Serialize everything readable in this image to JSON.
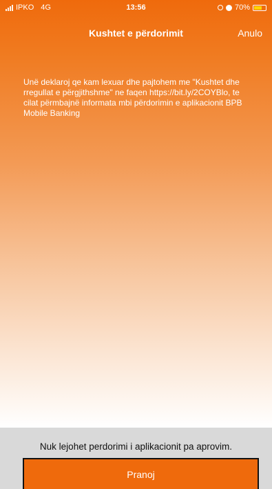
{
  "status_bar": {
    "carrier": "IPKO",
    "network": "4G",
    "time": "13:56",
    "battery": "70%",
    "battery_color": "#ffd400"
  },
  "nav": {
    "title": "Kushtet e përdorimit",
    "cancel_label": "Anulo"
  },
  "content": {
    "terms_text": "Unë deklaroj qe kam lexuar dhe pajtohem me \"Kushtet dhe rregullat e përgjithshme\" ne faqen https://bit.ly/2COYBlo, te cilat përmbajnë informata mbi përdorimin e aplikacionit BPB Mobile Banking"
  },
  "footer": {
    "notice": "Nuk lejohet perdorimi i aplikacionit pa aprovim.",
    "accept_label": "Pranoj"
  },
  "colors": {
    "accent": "#ef6a0c",
    "panel": "#d9d9d9"
  }
}
